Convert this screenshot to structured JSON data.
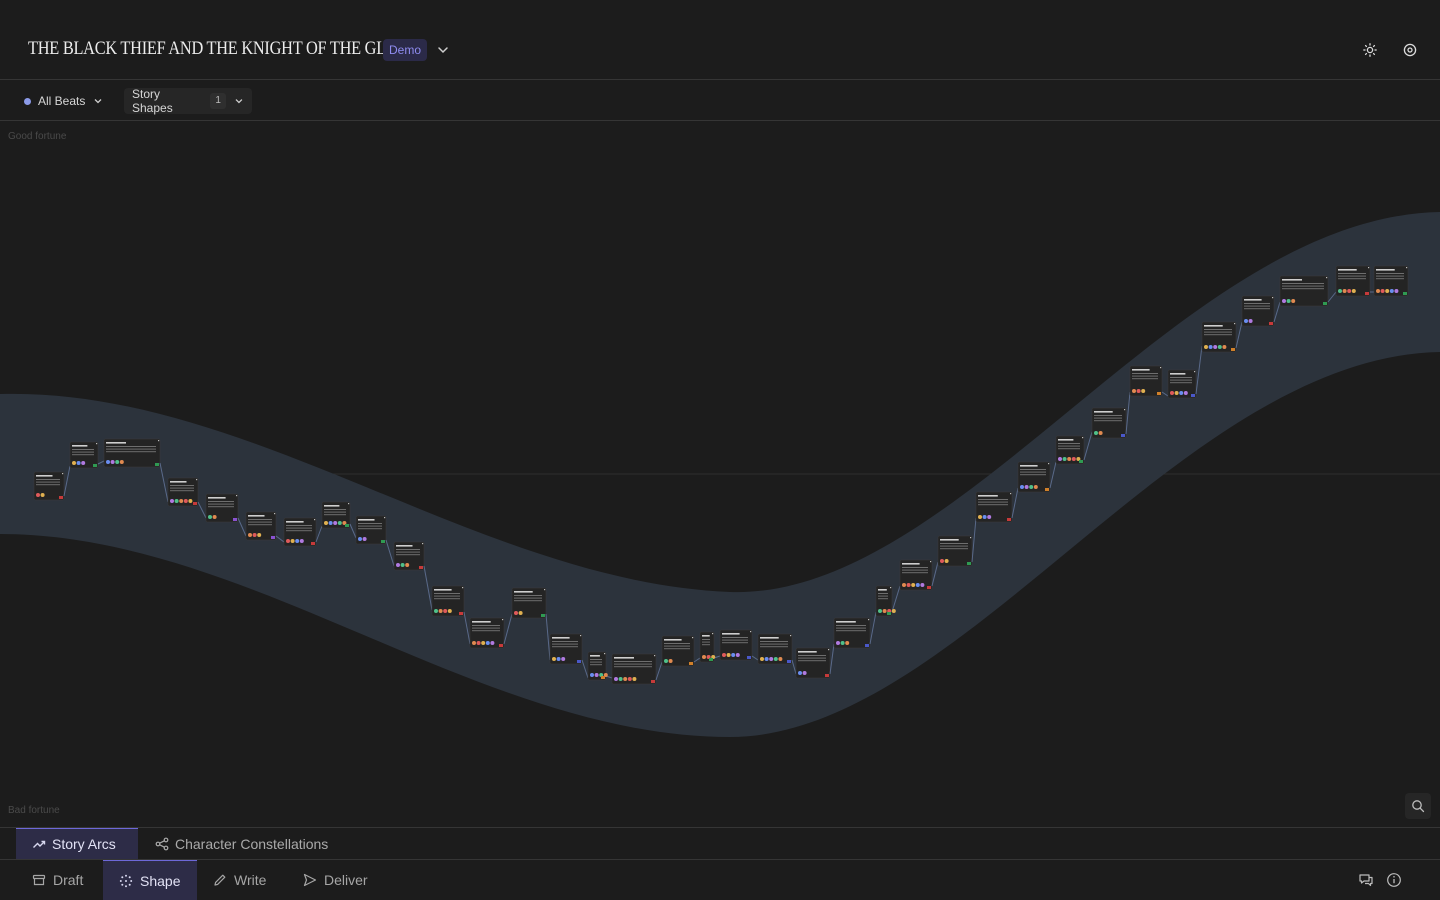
{
  "header": {
    "title": "THE BLACK THIEF AND THE KNIGHT OF THE GLEN",
    "badge": "Demo",
    "icons": [
      "chevron-down-icon",
      "sun-icon",
      "settings-icon"
    ]
  },
  "filters": {
    "all_beats": "All Beats",
    "story_shapes": "Story Shapes",
    "story_shapes_count": "1"
  },
  "canvas": {
    "top_label": "Good fortune",
    "bottom_label": "Bad fortune",
    "band_color": "#2c333c",
    "beat_count": 42
  },
  "view_tabs": [
    {
      "label": "Story Arcs",
      "icon": "trending-up-icon",
      "active": true
    },
    {
      "label": "Character Constellations",
      "icon": "share-nodes-icon",
      "active": false
    }
  ],
  "mode_tabs": [
    {
      "label": "Draft",
      "icon": "archive-icon",
      "active": false
    },
    {
      "label": "Shape",
      "icon": "shape-dots-icon",
      "active": true
    },
    {
      "label": "Write",
      "icon": "pencil-icon",
      "active": false
    },
    {
      "label": "Deliver",
      "icon": "send-icon",
      "active": false
    }
  ],
  "colors": {
    "accent": "#6d68d8",
    "badge_text": "#8f8cf0",
    "tag_red": "#c63a3a",
    "tag_green": "#2f9a52",
    "tag_blue": "#4a58c8",
    "tag_orange": "#d0802a",
    "tag_purple": "#8a52d0"
  }
}
